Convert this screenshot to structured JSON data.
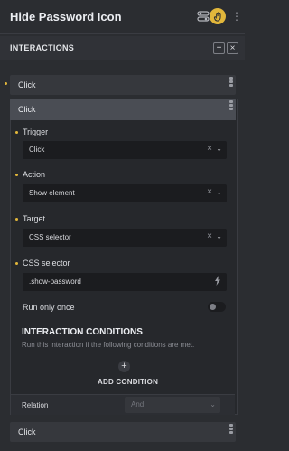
{
  "header": {
    "title": "Hide Password Icon"
  },
  "interactions_section": {
    "label": "INTERACTIONS",
    "add_symbol": "+",
    "clear_symbol": "×"
  },
  "interactions": [
    {
      "label": "Click"
    },
    {
      "label": "Click"
    },
    {
      "label": "Click"
    }
  ],
  "form": {
    "trigger": {
      "label": "Trigger",
      "value": "Click"
    },
    "action": {
      "label": "Action",
      "value": "Show element"
    },
    "target": {
      "label": "Target",
      "value": "CSS selector"
    },
    "css_selector": {
      "label": "CSS selector",
      "value": ".show-password"
    },
    "run_only_once": {
      "label": "Run only once",
      "checked": false
    }
  },
  "conditions": {
    "title": "INTERACTION CONDITIONS",
    "description": "Run this interaction if the following conditions are met.",
    "add_symbol": "+",
    "add_label": "ADD CONDITION"
  },
  "relation": {
    "label": "Relation",
    "value": "And"
  },
  "icons": [
    "toggle-icon",
    "hand-icon",
    "more-icon",
    "drag-handle-icon",
    "clear-icon",
    "chevron-down-icon",
    "bolt-icon",
    "plus-icon"
  ],
  "colors": {
    "accent": "#e2b73b",
    "background": "#2b2d31",
    "field": "#1b1c1f"
  }
}
